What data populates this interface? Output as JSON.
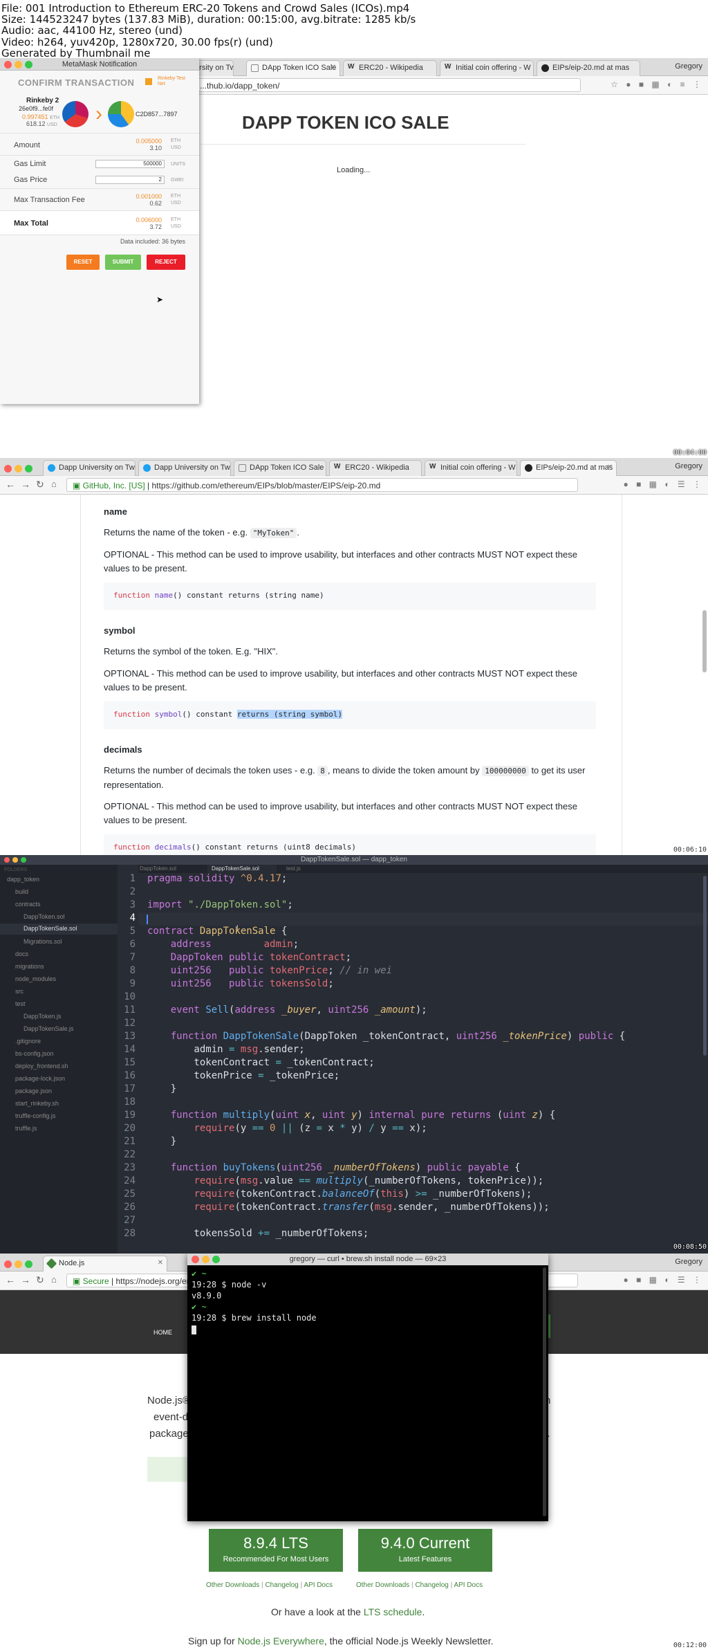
{
  "info": {
    "line1": "File: 001 Introduction to Ethereum ERC-20 Tokens and Crowd Sales (ICOs).mp4",
    "line2": "Size: 144523247 bytes (137.83 MiB), duration: 00:15:00, avg.bitrate: 1285 kb/s",
    "line3": "Audio: aac, 44100 Hz, stereo (und)",
    "line4": "Video: h264, yuv420p, 1280x720, 30.00 fps(r) (und)",
    "line5": "Generated by Thumbnail me"
  },
  "colors": {
    "metamask_orange": "#f08a24",
    "reset": "#f47b1f",
    "submit": "#72c55a",
    "reject": "#e91e28",
    "node_green": "#43853d",
    "github_link": "#0366d6"
  },
  "frame1": {
    "timestamp": "00:04:00",
    "tabs": [
      "...rsity on Tw",
      "DApp Token ICO Sale",
      "ERC20 - Wikipedia",
      "Initial coin offering - W",
      "EIPs/eip-20.md at mas"
    ],
    "user": "Gregory",
    "url": "...thub.io/dapp_token/",
    "heading": "DAPP TOKEN ICO SALE",
    "loading": "Loading...",
    "metamask": {
      "window_title": "MetaMask Notification",
      "confirm_title": "CONFIRM TRANSACTION",
      "network": "Rinkeby Test Net",
      "from_name": "Rinkeby 2",
      "from_address": "26e0f9...fe0f",
      "from_eth": "0.997451",
      "from_eth_unit": "ETH",
      "from_usd": "618.12",
      "from_usd_unit": "USD",
      "to_address": "C2D857...7897",
      "rows": [
        {
          "label": "Amount",
          "value": "0.005000",
          "unit": "ETH",
          "value2": "3.10",
          "unit2": "USD"
        },
        {
          "label": "Gas Limit",
          "value": "500000",
          "unit": "UNITS"
        },
        {
          "label": "Gas Price",
          "value": "2",
          "unit": "GWEI"
        },
        {
          "label": "Max Transaction Fee",
          "value": "0.001000",
          "unit": "ETH",
          "value2": "0.62",
          "unit2": "USD"
        }
      ],
      "total_label": "Max Total",
      "total_eth": "0.006000",
      "total_eth_unit": "ETH",
      "total_usd": "3.72",
      "total_usd_unit": "USD",
      "data_included": "Data included: 36 bytes",
      "reset": "RESET",
      "submit": "SUBMIT",
      "reject": "REJECT"
    }
  },
  "frame2": {
    "timestamp": "00:06:10",
    "tabs": [
      "Dapp University on Tw",
      "Dapp University on Tw",
      "DApp Token ICO Sale",
      "ERC20 - Wikipedia",
      "Initial coin offering - W",
      "EIPs/eip-20.md at mas"
    ],
    "user": "Gregory",
    "secure_label": "GitHub, Inc. [US]",
    "url": "https://github.com/ethereum/EIPs/blob/master/EIPS/eip-20.md",
    "name_heading": "name",
    "name_desc_pre": "Returns the name of the token - e.g. ",
    "name_example": "\"MyToken\"",
    "name_desc_post": ".",
    "optional1": "OPTIONAL - This method can be used to improve usability, but interfaces and other contracts MUST NOT expect these values to be present.",
    "code1_kw": "function",
    "code1_fn": "name",
    "code1_rest": "() constant returns (string name)",
    "symbol_heading": "symbol",
    "symbol_desc": "Returns the symbol of the token. E.g. \"HIX\".",
    "optional2": "OPTIONAL - This method can be used to improve usability, but interfaces and other contracts MUST NOT expect these values to be present.",
    "code2_kw": "function",
    "code2_fn": "symbol",
    "code2_rest1": "() constant ",
    "code2_sel": "returns (string symbol)",
    "decimals_heading": "decimals",
    "decimals_pre": "Returns the number of decimals the token uses - e.g. ",
    "decimals_ex1": "8",
    "decimals_mid": ", means to divide the token amount by ",
    "decimals_ex2": "100000000",
    "decimals_post": " to get its user representation.",
    "optional3": "OPTIONAL - This method can be used to improve usability, but interfaces and other contracts MUST NOT expect these values to be present.",
    "code3_kw": "function",
    "code3_fn": "decimals",
    "code3_rest": "() constant returns (uint8 decimals)"
  },
  "frame3": {
    "timestamp": "00:08:50",
    "window_title": "DappTokenSale.sol — dapp_token",
    "tabs": [
      "DappToken.sol",
      "DappTokenSale.sol",
      "test.js"
    ],
    "tree_header": "FOLDERS",
    "tree": [
      "dapp_token",
      "build",
      "contracts",
      "DappToken.sol",
      "DappTokenSale.sol",
      "Migrations.sol",
      "docs",
      "migrations",
      "node_modules",
      "src",
      "test",
      "DappToken.js",
      "DappTokenSale.js",
      ".gitignore",
      "bs-config.json",
      "deploy_frontend.sh",
      "package-lock.json",
      "package.json",
      "start_rinkeby.sh",
      "truffle-config.js",
      "truffle.js"
    ],
    "line_numbers": [
      "1",
      "2",
      "3",
      "4",
      "5",
      "6",
      "7",
      "8",
      "9",
      "10",
      "11",
      "12",
      "13",
      "14",
      "15",
      "16",
      "17",
      "18",
      "19",
      "20",
      "21",
      "22",
      "23",
      "24",
      "25",
      "26",
      "27",
      "28"
    ]
  },
  "frame4": {
    "timestamp": "00:12:00",
    "tab": "Node.js",
    "user": "Gregory",
    "secure": "Secure",
    "url": "https://nodejs.org/en/",
    "nav_home": "HOME",
    "terminal_title": "gregory — curl • brew.sh install node — 69×23",
    "terminal": [
      "✔ ~",
      "19:28 $ node -v",
      "v8.9.0",
      "✔ ~",
      "19:28 $ brew install node"
    ],
    "intro1": "Node.js®",
    "intro1r": "n",
    "intro2": "event-d",
    "intro3": "package",
    "intro3r": "l.",
    "lts_version": "8.9.4 LTS",
    "lts_sub": "Recommended For Most Users",
    "cur_version": "9.4.0 Current",
    "cur_sub": "Latest Features",
    "links_lts": [
      "Other Downloads",
      "Changelog",
      "API Docs"
    ],
    "links_cur": [
      "Other Downloads",
      "Changelog",
      "API Docs"
    ],
    "lts_pre": "Or have a look at the ",
    "lts_link": "LTS schedule",
    "lts_post": ".",
    "signup_pre": "Sign up for ",
    "signup_link": "Node.js Everywhere",
    "signup_post": ", the official Node.js Weekly Newsletter."
  }
}
